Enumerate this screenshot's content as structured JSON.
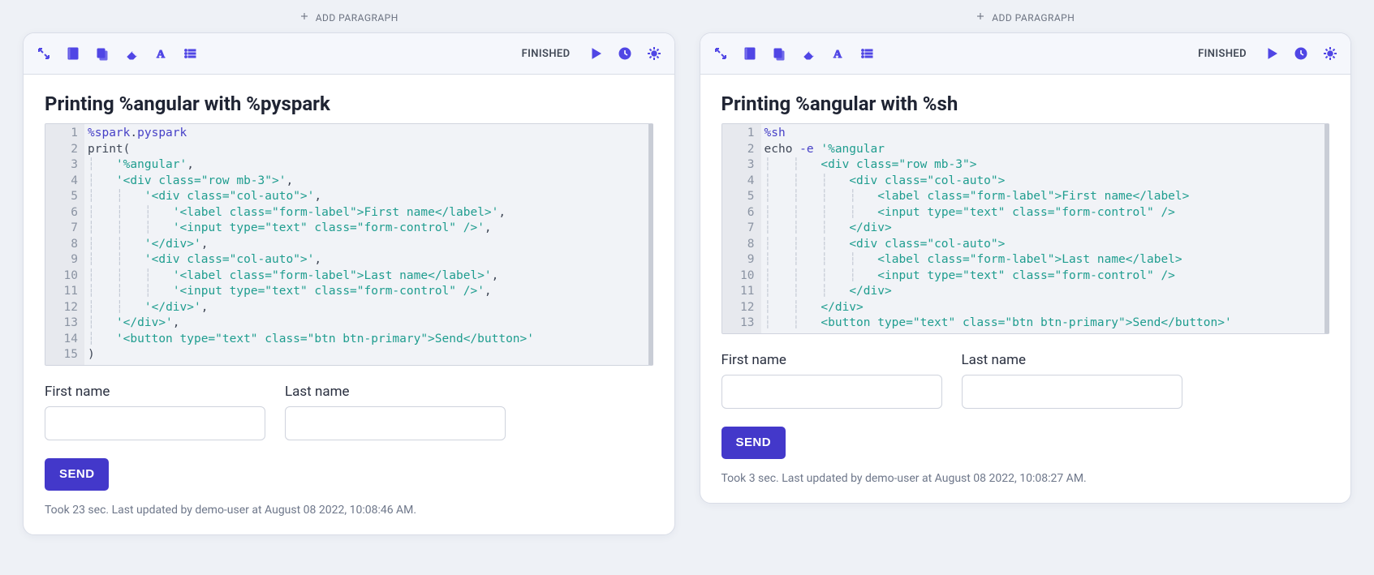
{
  "addParagraphLabel": "ADD PARAGRAPH",
  "panels": [
    {
      "status": "FINISHED",
      "title": "Printing %angular with %pyspark",
      "code": {
        "lang": "pyspark",
        "lines": [
          [
            {
              "t": "kw",
              "v": "%spark"
            },
            {
              "t": "plain",
              "v": "."
            },
            {
              "t": "kw",
              "v": "pyspark"
            }
          ],
          [
            {
              "t": "plain",
              "v": "print("
            }
          ],
          [
            {
              "t": "plain",
              "v": "    "
            },
            {
              "t": "str",
              "v": "'%angular'"
            },
            {
              "t": "plain",
              "v": ","
            }
          ],
          [
            {
              "t": "plain",
              "v": "    "
            },
            {
              "t": "str",
              "v": "'<div class=\"row mb-3\">'"
            },
            {
              "t": "plain",
              "v": ","
            }
          ],
          [
            {
              "t": "plain",
              "v": "        "
            },
            {
              "t": "str",
              "v": "'<div class=\"col-auto\">'"
            },
            {
              "t": "plain",
              "v": ","
            }
          ],
          [
            {
              "t": "plain",
              "v": "            "
            },
            {
              "t": "str",
              "v": "'<label class=\"form-label\">First name</label>'"
            },
            {
              "t": "plain",
              "v": ","
            }
          ],
          [
            {
              "t": "plain",
              "v": "            "
            },
            {
              "t": "str",
              "v": "'<input type=\"text\" class=\"form-control\" />'"
            },
            {
              "t": "plain",
              "v": ","
            }
          ],
          [
            {
              "t": "plain",
              "v": "        "
            },
            {
              "t": "str",
              "v": "'</div>'"
            },
            {
              "t": "plain",
              "v": ","
            }
          ],
          [
            {
              "t": "plain",
              "v": "        "
            },
            {
              "t": "str",
              "v": "'<div class=\"col-auto\">'"
            },
            {
              "t": "plain",
              "v": ","
            }
          ],
          [
            {
              "t": "plain",
              "v": "            "
            },
            {
              "t": "str",
              "v": "'<label class=\"form-label\">Last name</label>'"
            },
            {
              "t": "plain",
              "v": ","
            }
          ],
          [
            {
              "t": "plain",
              "v": "            "
            },
            {
              "t": "str",
              "v": "'<input type=\"text\" class=\"form-control\" />'"
            },
            {
              "t": "plain",
              "v": ","
            }
          ],
          [
            {
              "t": "plain",
              "v": "        "
            },
            {
              "t": "str",
              "v": "'</div>'"
            },
            {
              "t": "plain",
              "v": ","
            }
          ],
          [
            {
              "t": "plain",
              "v": "    "
            },
            {
              "t": "str",
              "v": "'</div>'"
            },
            {
              "t": "plain",
              "v": ","
            }
          ],
          [
            {
              "t": "plain",
              "v": "    "
            },
            {
              "t": "str",
              "v": "'<button type=\"text\" class=\"btn btn-primary\">Send</button>'"
            }
          ],
          [
            {
              "t": "plain",
              "v": ")"
            }
          ]
        ]
      },
      "form": {
        "firstLabel": "First name",
        "lastLabel": "Last name",
        "sendLabel": "SEND"
      },
      "footer": "Took 23 sec. Last updated by demo-user at August 08 2022, 10:08:46 AM."
    },
    {
      "status": "FINISHED",
      "title": "Printing %angular with %sh",
      "code": {
        "lang": "sh",
        "lines": [
          [
            {
              "t": "kw",
              "v": "%sh"
            }
          ],
          [
            {
              "t": "plain",
              "v": "echo "
            },
            {
              "t": "kw",
              "v": "-e"
            },
            {
              "t": "plain",
              "v": " "
            },
            {
              "t": "str",
              "v": "'%angular"
            }
          ],
          [
            {
              "t": "plain",
              "v": "        "
            },
            {
              "t": "str",
              "v": "<div class=\"row mb-3\">"
            }
          ],
          [
            {
              "t": "plain",
              "v": "            "
            },
            {
              "t": "str",
              "v": "<div class=\"col-auto\">"
            }
          ],
          [
            {
              "t": "plain",
              "v": "                "
            },
            {
              "t": "str",
              "v": "<label class=\"form-label\">First name</label>"
            }
          ],
          [
            {
              "t": "plain",
              "v": "                "
            },
            {
              "t": "str",
              "v": "<input type=\"text\" class=\"form-control\" />"
            }
          ],
          [
            {
              "t": "plain",
              "v": "            "
            },
            {
              "t": "str",
              "v": "</div>"
            }
          ],
          [
            {
              "t": "plain",
              "v": "            "
            },
            {
              "t": "str",
              "v": "<div class=\"col-auto\">"
            }
          ],
          [
            {
              "t": "plain",
              "v": "                "
            },
            {
              "t": "str",
              "v": "<label class=\"form-label\">Last name</label>"
            }
          ],
          [
            {
              "t": "plain",
              "v": "                "
            },
            {
              "t": "str",
              "v": "<input type=\"text\" class=\"form-control\" />"
            }
          ],
          [
            {
              "t": "plain",
              "v": "            "
            },
            {
              "t": "str",
              "v": "</div>"
            }
          ],
          [
            {
              "t": "plain",
              "v": "        "
            },
            {
              "t": "str",
              "v": "</div>"
            }
          ],
          [
            {
              "t": "plain",
              "v": "        "
            },
            {
              "t": "str",
              "v": "<button type=\"text\" class=\"btn btn-primary\">Send</button>'"
            }
          ]
        ]
      },
      "form": {
        "firstLabel": "First name",
        "lastLabel": "Last name",
        "sendLabel": "SEND"
      },
      "footer": "Took 3 sec. Last updated by demo-user at August 08 2022, 10:08:27 AM."
    }
  ],
  "icons": {
    "leftToolbar": [
      "collapse-icon",
      "book-icon",
      "copy-icon",
      "eraser-icon",
      "font-icon",
      "list-icon"
    ],
    "rightToolbar": [
      "play-icon",
      "clock-icon",
      "gear-icon"
    ]
  }
}
